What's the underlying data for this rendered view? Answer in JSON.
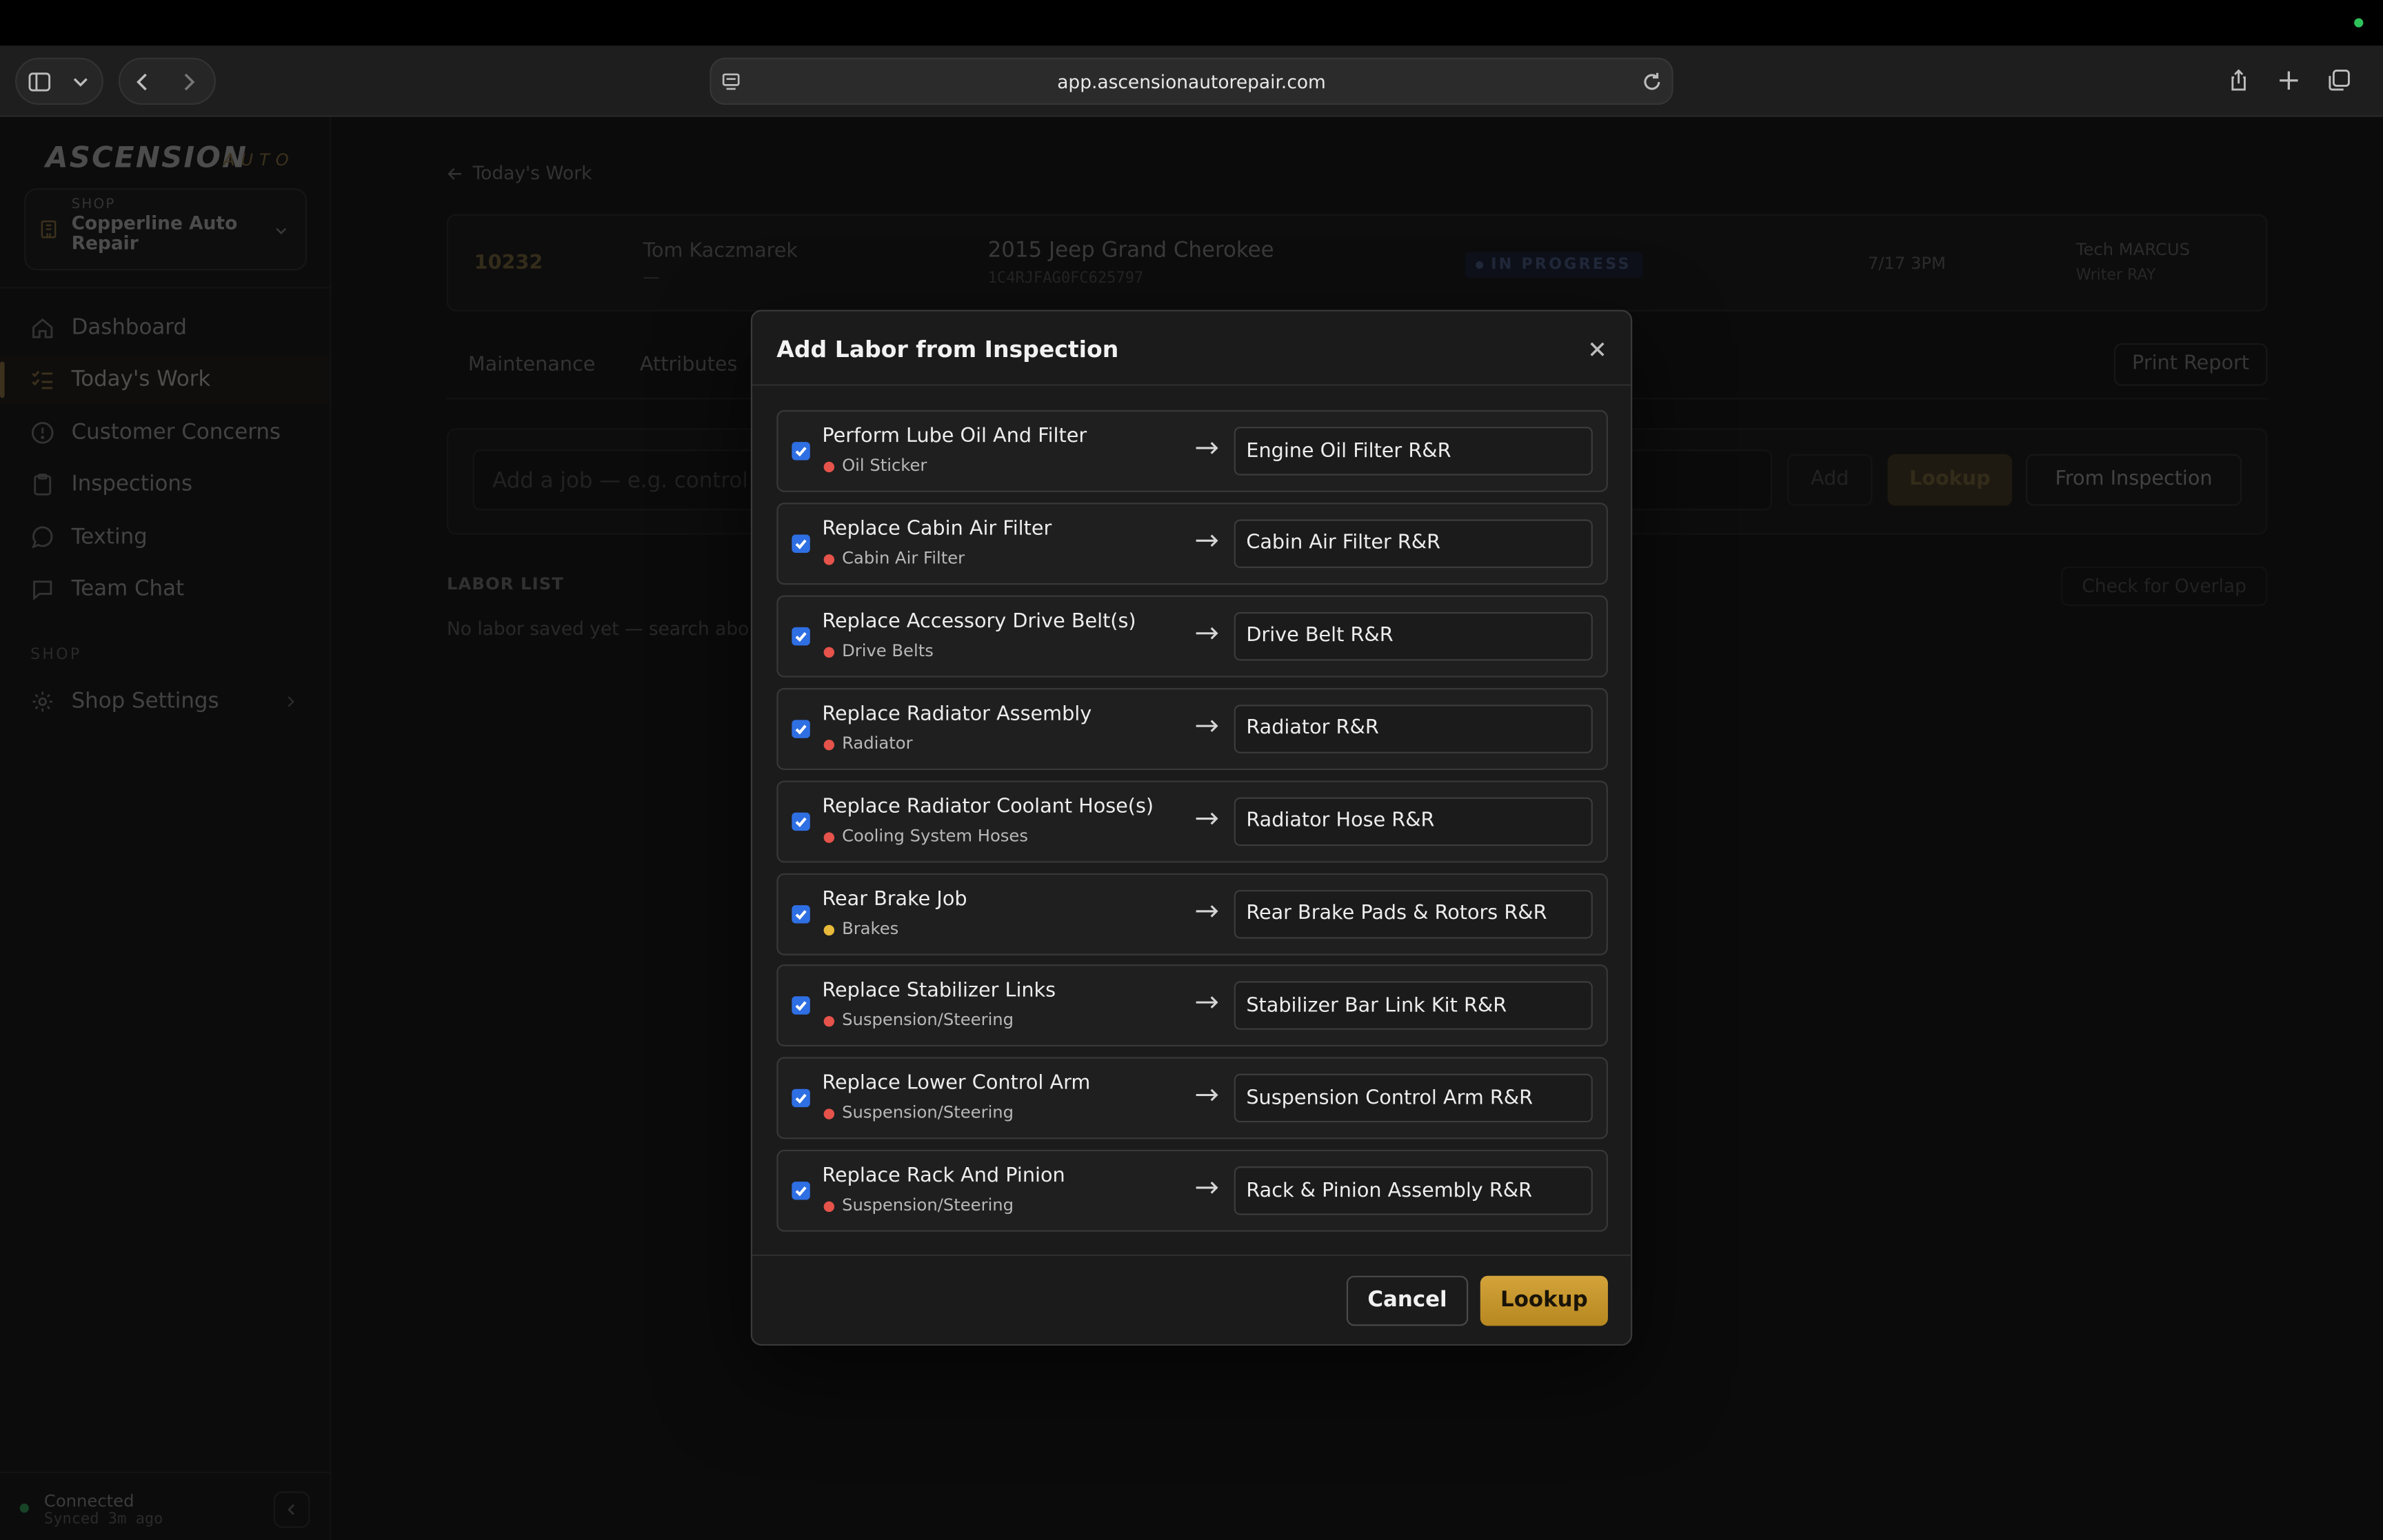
{
  "browser": {
    "url": "app.ascensionautorepair.com"
  },
  "sidebar": {
    "logo": "ASCENSION",
    "logo_sub": "AUTO",
    "shop_label": "SHOP",
    "shop_name": "Copperline Auto Repair",
    "nav": [
      {
        "label": "Dashboard",
        "icon": "home-icon"
      },
      {
        "label": "Today's Work",
        "icon": "checklist-icon",
        "active": true
      },
      {
        "label": "Customer Concerns",
        "icon": "alert-circle-icon"
      },
      {
        "label": "Inspections",
        "icon": "clipboard-icon"
      },
      {
        "label": "Texting",
        "icon": "message-circle-icon"
      },
      {
        "label": "Team Chat",
        "icon": "message-square-icon"
      }
    ],
    "section_shop": "SHOP",
    "shop_settings": "Shop Settings",
    "status": "Connected",
    "synced": "Synced 3m ago"
  },
  "main": {
    "back_label": "Today's Work",
    "ro": {
      "number": "10232",
      "customer": "Tom Kaczmarek",
      "customer_sub": "—",
      "vehicle": "2015 Jeep Grand Cherokee",
      "vin": "1C4RJFAG0FC625797",
      "status": "IN PROGRESS",
      "date": "7/17 3PM",
      "tech": "Tech MARCUS",
      "writer": "Writer RAY"
    },
    "tabs": [
      "Maintenance",
      "Attributes"
    ],
    "print_report": "Print Report",
    "job_placeholder": "Add a job — e.g. control ar",
    "add": "Add",
    "lookup": "Lookup",
    "from_inspection": "From Inspection",
    "labor_list": "LABOR LIST",
    "check_overlap": "Check for Overlap",
    "labor_empty": "No labor saved yet — search abo"
  },
  "modal": {
    "title": "Add Labor from Inspection",
    "rows": [
      {
        "name": "Perform Lube Oil And Filter",
        "category": "Oil Sticker",
        "dot_color": "#e5534b",
        "target": "Engine Oil Filter R&R",
        "checked": true
      },
      {
        "name": "Replace Cabin Air Filter",
        "category": "Cabin Air Filter",
        "dot_color": "#e5534b",
        "target": "Cabin Air Filter R&R",
        "checked": true
      },
      {
        "name": "Replace Accessory Drive Belt(s)",
        "category": "Drive Belts",
        "dot_color": "#e5534b",
        "target": "Drive Belt R&R",
        "checked": true
      },
      {
        "name": "Replace Radiator Assembly",
        "category": "Radiator",
        "dot_color": "#e5534b",
        "target": "Radiator R&R",
        "checked": true
      },
      {
        "name": "Replace Radiator Coolant Hose(s)",
        "category": "Cooling System Hoses",
        "dot_color": "#e5534b",
        "target": "Radiator Hose R&R",
        "checked": true
      },
      {
        "name": "Rear Brake Job",
        "category": "Brakes",
        "dot_color": "#e8b93a",
        "target": "Rear Brake Pads & Rotors R&R",
        "checked": true
      },
      {
        "name": "Replace Stabilizer Links",
        "category": "Suspension/Steering",
        "dot_color": "#e5534b",
        "target": "Stabilizer Bar Link Kit R&R",
        "checked": true
      },
      {
        "name": "Replace Lower Control Arm",
        "category": "Suspension/Steering",
        "dot_color": "#e5534b",
        "target": "Suspension Control Arm R&R",
        "checked": true
      },
      {
        "name": "Replace Rack And Pinion",
        "category": "Suspension/Steering",
        "dot_color": "#e5534b",
        "target": "Rack & Pinion Assembly R&R",
        "checked": true
      }
    ],
    "cancel": "Cancel",
    "lookup": "Lookup"
  },
  "colors": {
    "accent_gold": "#c9992e",
    "checkbox_blue": "#2f6fe4"
  }
}
